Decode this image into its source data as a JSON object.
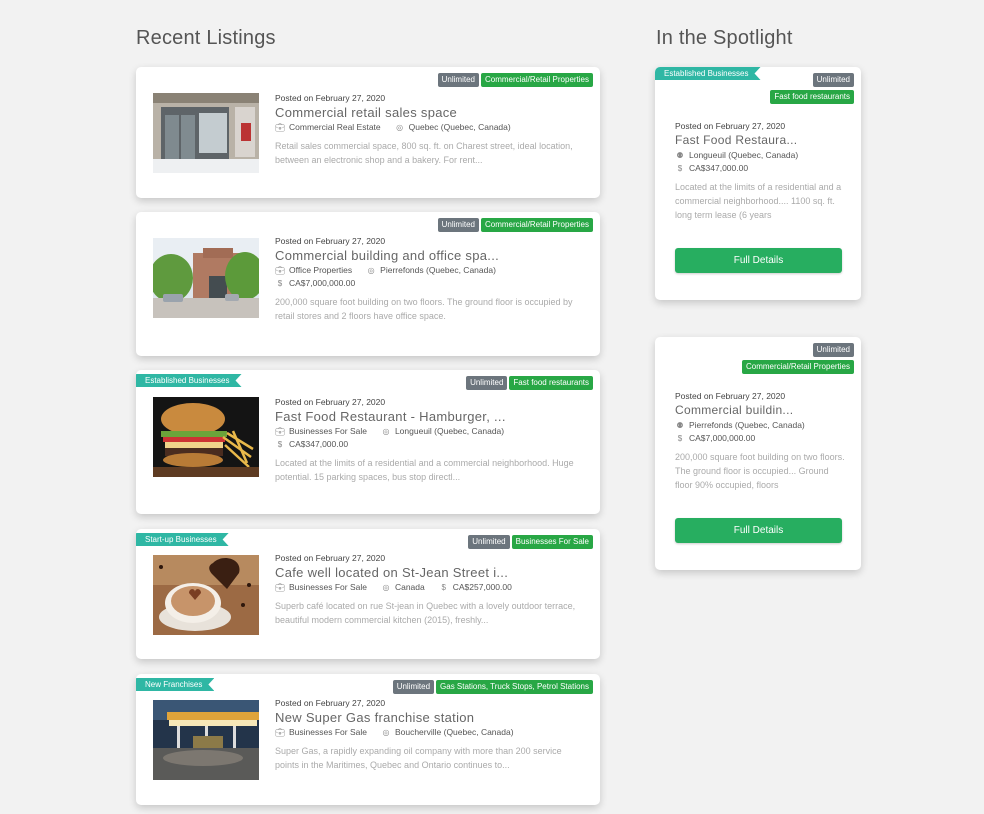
{
  "sections": {
    "recent_title": "Recent Listings",
    "spotlight_title": "In the Spotlight"
  },
  "icons": {
    "category": "briefcase-icon",
    "location": "globe-icon",
    "price": "dollar-icon",
    "pin": "map-pin-icon"
  },
  "colors": {
    "badge_grey": "#6c757d",
    "badge_green": "#28a745",
    "ribbon_teal": "#2fb7a4",
    "button_green": "#27ae60"
  },
  "listings": [
    {
      "ribbon": null,
      "badges": [
        "Unlimited",
        "Commercial/Retail Properties"
      ],
      "posted": "Posted on February 27, 2020",
      "title": "Commercial retail sales space",
      "category": "Commercial Real Estate",
      "location": "Quebec (Quebec, Canada)",
      "price": null,
      "description": "Retail sales commercial space, 800 sq. ft. on Charest street, ideal location, between an electronic shop and a bakery. For rent..."
    },
    {
      "ribbon": null,
      "badges": [
        "Unlimited",
        "Commercial/Retail Properties"
      ],
      "posted": "Posted on February 27, 2020",
      "title": "Commercial building and office spa...",
      "category": "Office Properties",
      "location": "Pierrefonds (Quebec, Canada)",
      "price": "CA$7,000,000.00",
      "description": "200,000 square foot building on two floors. The ground floor is occupied by retail stores and 2 floors have office space."
    },
    {
      "ribbon": "Established Businesses",
      "badges": [
        "Unlimited",
        "Fast food restaurants"
      ],
      "posted": "Posted on February 27, 2020",
      "title": "Fast Food Restaurant - Hamburger, ...",
      "category": "Businesses For Sale",
      "location": "Longueuil (Quebec, Canada)",
      "price": "CA$347,000.00",
      "description": "Located at the limits of a residential and a commercial neighborhood. Huge potential. 15 parking spaces, bus stop directl..."
    },
    {
      "ribbon": "Start-up Businesses",
      "badges": [
        "Unlimited",
        "Businesses For Sale"
      ],
      "posted": "Posted on February 27, 2020",
      "title": "Cafe well located on St-Jean Street i...",
      "category": "Businesses For Sale",
      "location": "Canada",
      "price": "CA$257,000.00",
      "description": "Superb café located on rue St-jean in Quebec with a lovely outdoor terrace, beautiful modern commercial kitchen (2015), freshly..."
    },
    {
      "ribbon": "New Franchises",
      "badges": [
        "Unlimited",
        "Gas Stations, Truck Stops, Petrol Stations"
      ],
      "posted": "Posted on February 27, 2020",
      "title": "New Super Gas franchise station",
      "category": "Businesses For Sale",
      "location": "Boucherville (Quebec, Canada)",
      "price": null,
      "description": "Super Gas, a rapidly expanding oil company with more than 200 service points in the Maritimes, Quebec and Ontario continues to..."
    }
  ],
  "spotlight": [
    {
      "ribbon": "Established Businesses",
      "badges": [
        "Unlimited",
        "Fast food restaurants"
      ],
      "posted": "Posted on February 27, 2020",
      "title": "Fast Food Restaura...",
      "location": "Longueuil (Quebec, Canada)",
      "price": "CA$347,000.00",
      "description": "Located at the limits of a residential and a commercial neighborhood.... 1100 sq. ft. long term lease (6 years",
      "button": "Full Details"
    },
    {
      "ribbon": null,
      "badges": [
        "Unlimited",
        "Commercial/Retail Properties"
      ],
      "posted": "Posted on February 27, 2020",
      "title": "Commercial buildin...",
      "location": "Pierrefonds (Quebec, Canada)",
      "price": "CA$7,000,000.00",
      "description": "200,000 square foot building on two floors. The ground floor is occupied... Ground floor 90% occupied, floors",
      "button": "Full Details"
    }
  ]
}
